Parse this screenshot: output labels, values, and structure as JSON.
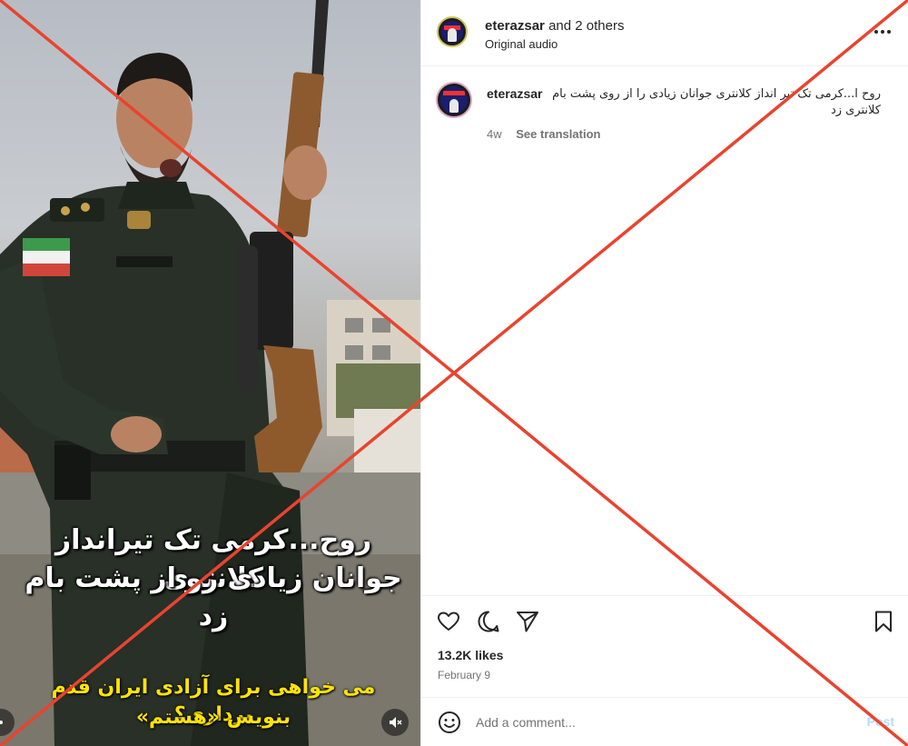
{
  "video": {
    "caption_line_1": "روح...کرمی تک تیرانداز کلانتری",
    "caption_line_2": "جوانان زیادی رو از پشت بام زد",
    "caption_line_3": "می خواهی برای آزادی ایران قدم برداری؟",
    "caption_line_4": "بنویس «هستم»",
    "mute_icon": "speaker-muted-icon"
  },
  "header": {
    "username": "eterazsar",
    "others": "and 2 others",
    "audio_label": "Original audio",
    "more_icon": "more-horizontal-icon"
  },
  "caption": {
    "username": "eterazsar",
    "text": "روح ا...کرمی تک تیر انداز کلانتری جوانان زیادی را از روی پشت بام کلانتری زد",
    "age": "4w",
    "see_translation": "See translation"
  },
  "actions": {
    "like_icon": "heart-icon",
    "comment_icon": "comment-icon",
    "share_icon": "send-icon",
    "save_icon": "bookmark-icon",
    "likes": "13.2K likes",
    "date": "February 9"
  },
  "comment_box": {
    "placeholder": "Add a comment...",
    "post_label": "Post",
    "emoji_icon": "emoji-icon"
  },
  "overlay": {
    "cross_color": "#e8442f"
  }
}
